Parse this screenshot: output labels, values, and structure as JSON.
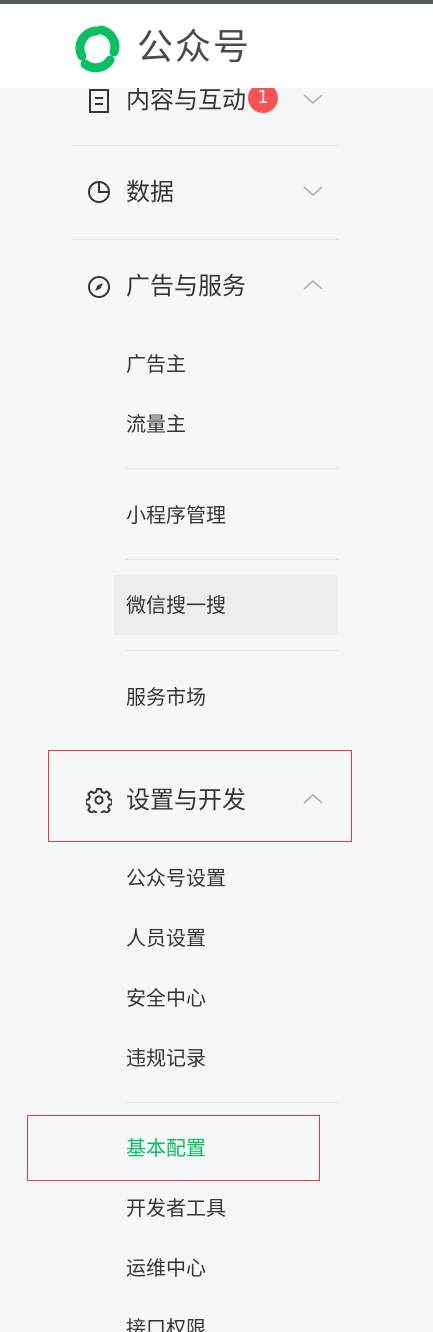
{
  "header": {
    "brand": "公众号"
  },
  "menu": {
    "content": {
      "label": "内容与互动",
      "badge": "1"
    },
    "data": {
      "label": "数据"
    },
    "ads": {
      "label": "广告与服务",
      "items": [
        "广告主",
        "流量主",
        "小程序管理",
        "微信搜一搜",
        "服务市场"
      ]
    },
    "settings": {
      "label": "设置与开发",
      "items": [
        "公众号设置",
        "人员设置",
        "安全中心",
        "违规记录",
        "基本配置",
        "开发者工具",
        "运维中心",
        "接口权限"
      ]
    }
  },
  "colors": {
    "accent": "#07c160",
    "badge": "#fa5151",
    "annotation": "#e5393f"
  }
}
